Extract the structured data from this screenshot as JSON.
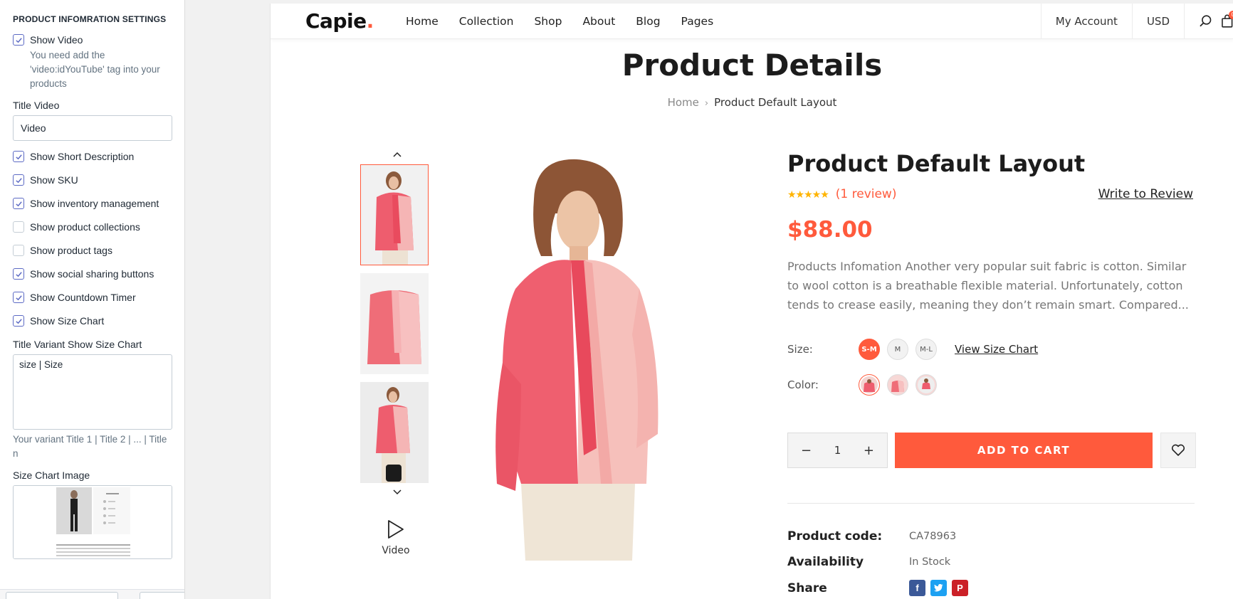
{
  "panel": {
    "heading": "PRODUCT INFOMRATION SETTINGS",
    "show_video": {
      "label": "Show Video",
      "checked": true,
      "help": "You need add the 'video:idYouTube' tag into your products"
    },
    "title_video": {
      "label": "Title Video",
      "value": "Video"
    },
    "checkboxes": [
      {
        "label": "Show Short Description",
        "checked": true
      },
      {
        "label": "Show SKU",
        "checked": true
      },
      {
        "label": "Show inventory management",
        "checked": true
      },
      {
        "label": "Show product collections",
        "checked": false
      },
      {
        "label": "Show product tags",
        "checked": false
      },
      {
        "label": "Show social sharing buttons",
        "checked": true
      },
      {
        "label": "Show Countdown Timer",
        "checked": true
      },
      {
        "label": "Show Size Chart",
        "checked": true
      }
    ],
    "size_chart_title": {
      "label": "Title Variant Show Size Chart",
      "value": "size | Size",
      "help": "Your variant Title 1 | Title 2 | ... | Title n"
    },
    "size_chart_image": {
      "label": "Size Chart Image"
    }
  },
  "store": {
    "logo": "Capie",
    "logo_dot": ".",
    "nav": [
      "Home",
      "Collection",
      "Shop",
      "About",
      "Blog",
      "Pages"
    ],
    "account": "My Account",
    "currency": "USD",
    "cart_count": "0"
  },
  "page": {
    "title": "Product Details",
    "breadcrumb_home": "Home",
    "breadcrumb_current": "Product Default Layout"
  },
  "gallery": {
    "video_label": "Video"
  },
  "product": {
    "title": "Product Default Layout",
    "rating": 5,
    "stars": "★★★★★",
    "review_count": "(1 review)",
    "write_review": "Write to Review",
    "price": "$88.00",
    "description": "Products Infomation Another very popular suit fabric is cotton. Similar to wool cotton is a breathable flexible material. Unfortunately, cotton tends to crease easily, meaning they don’t remain smart. Compared...",
    "size_label": "Size:",
    "sizes": [
      "S-M",
      "M",
      "M-L"
    ],
    "selected_size": "S-M",
    "size_chart_link": "View Size Chart",
    "color_label": "Color:",
    "quantity": "1",
    "qty_minus": "−",
    "qty_plus": "+",
    "add_to_cart": "ADD TO CART",
    "meta": {
      "code_label": "Product code:",
      "code": "CA78963",
      "availability_label": "Availability",
      "availability": "In Stock",
      "share_label": "Share"
    },
    "share_colors": {
      "facebook": "#3b5998",
      "twitter": "#1da1f2",
      "pinterest": "#cb2027"
    },
    "accent_color": "#ff5a3c"
  }
}
